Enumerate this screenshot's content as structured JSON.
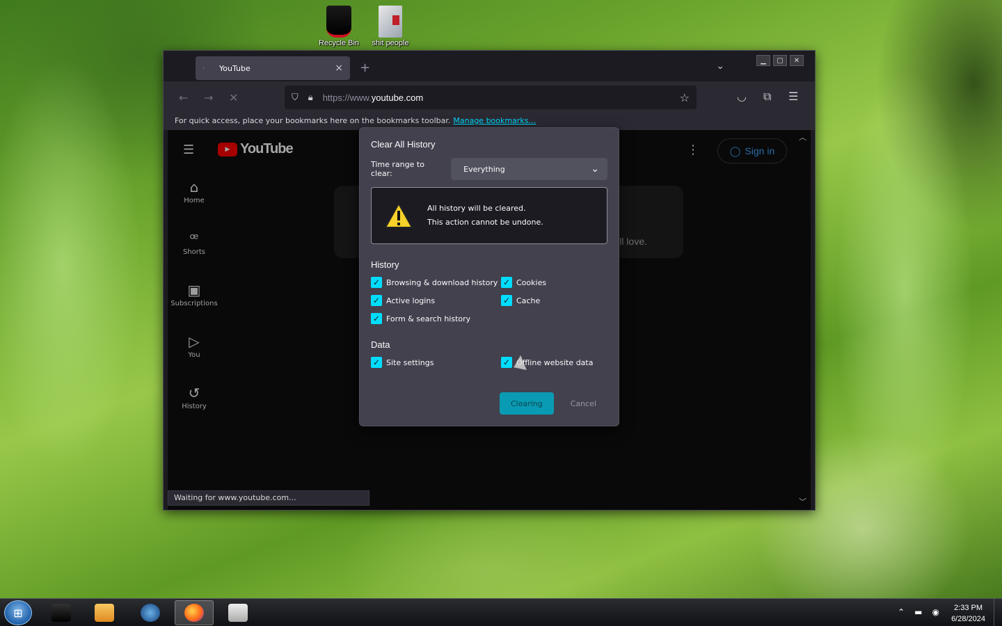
{
  "desktop": {
    "icons": [
      {
        "label": "Recycle Bin",
        "icon": "recycle-bin-icon"
      },
      {
        "label": "shit people",
        "icon": "file-icon"
      }
    ]
  },
  "browser": {
    "tab": {
      "title": "YouTube",
      "close": "×"
    },
    "newtab": "+",
    "url": {
      "scheme": "https://www.",
      "host": "youtube.com"
    },
    "bookmarks": {
      "text": "For quick access, place your bookmarks here on the bookmarks toolbar.",
      "link": "Manage bookmarks…"
    },
    "status": "Waiting for www.youtube.com..."
  },
  "youtube": {
    "logo": "YouTube",
    "nav": [
      {
        "label": "Home",
        "icon": "home-icon"
      },
      {
        "label": "Shorts",
        "icon": "shorts-icon"
      },
      {
        "label": "Subscriptions",
        "icon": "subscriptions-icon"
      },
      {
        "label": "You",
        "icon": "you-icon"
      },
      {
        "label": "History",
        "icon": "history-icon"
      }
    ],
    "hint": "'ll love.",
    "signin": "Sign in"
  },
  "dialog": {
    "title": "Clear All History",
    "range_label": "Time range to clear:",
    "range_value": "Everything",
    "warning_line1": "All history will be cleared.",
    "warning_line2": "This action cannot be undone.",
    "history_heading": "History",
    "history_items": [
      "Browsing & download history",
      "Cookies",
      "Active logins",
      "Cache",
      "Form & search history"
    ],
    "data_heading": "Data",
    "data_items": [
      "Site settings",
      "Offline website data"
    ],
    "ok_label": "Clearing",
    "cancel_label": "Cancel",
    "accent": "#00ddff"
  },
  "taskbar": {
    "time": "2:33 PM",
    "date": "6/28/2024"
  }
}
